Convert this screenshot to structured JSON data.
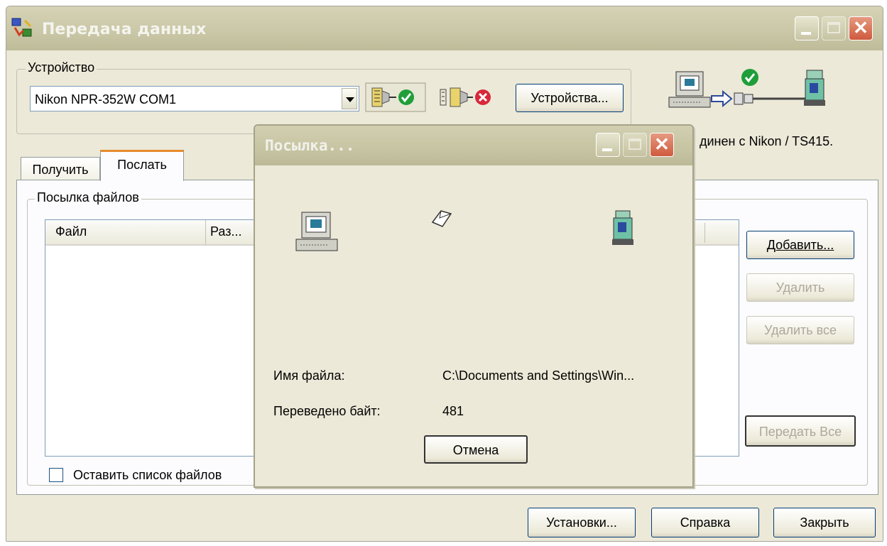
{
  "window": {
    "title": "Передача данных",
    "icon": "transfer-app-icon"
  },
  "device_group": {
    "legend": "Устройство",
    "selected_device": "Nikon NPR-352W COM1",
    "devices_button": "Устройства...",
    "connect_icon": "connect-check-icon",
    "disconnect_icon": "disconnect-x-icon",
    "status_text": "динен с Nikon / TS415."
  },
  "tabs": [
    {
      "label": "Получить"
    },
    {
      "label": "Послать"
    }
  ],
  "send_group": {
    "legend": "Посылка файлов",
    "columns": [
      "Файл",
      "Раз..."
    ],
    "buttons": {
      "add": "Добавить...",
      "delete": "Удалить",
      "delete_all": "Удалить все",
      "send_all": "Передать Все"
    },
    "keep_list_label": "Оставить список файлов"
  },
  "footer": {
    "settings": "Установки...",
    "help": "Справка",
    "close": "Закрыть"
  },
  "dialog": {
    "title": "Посылка...",
    "filename_label": "Имя файла:",
    "filename_value": "C:\\Documents and Settings\\Win...",
    "bytes_label": "Переведено байт:",
    "bytes_value": "481",
    "cancel": "Отмена"
  },
  "colors": {
    "title_bar": "#c9c7a6",
    "window_bg": "#ece9d8",
    "close_red": "#cf5a3e",
    "accent_tab": "#e68b2c",
    "check_green": "#1f9e3a"
  }
}
